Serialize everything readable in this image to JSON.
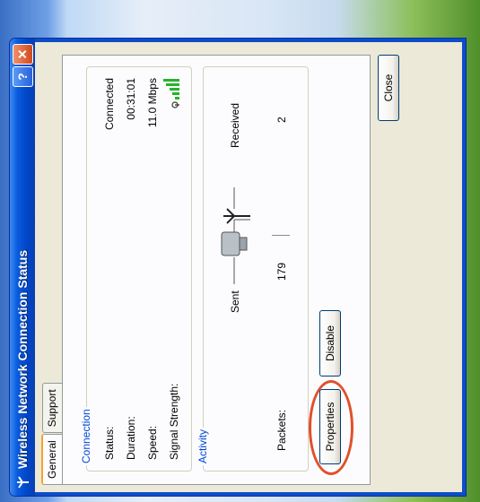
{
  "window": {
    "title": "Wireless Network Connection Status",
    "help_label": "?",
    "close_label": "✕"
  },
  "tabs": [
    {
      "label": "General"
    },
    {
      "label": "Support"
    }
  ],
  "connection": {
    "title": "Connection",
    "status_label": "Status:",
    "status_value": "Connected",
    "duration_label": "Duration:",
    "duration_value": "00:31:01",
    "speed_label": "Speed:",
    "speed_value": "11.0 Mbps",
    "signal_label": "Signal Strength:",
    "signal_bars": 5
  },
  "activity": {
    "title": "Activity",
    "sent_label": "Sent",
    "received_label": "Received",
    "packets_label": "Packets:",
    "packets_sent": "179",
    "packets_received": "2"
  },
  "buttons": {
    "properties": "Properties",
    "disable": "Disable",
    "close": "Close"
  },
  "colors": {
    "highlight_ring": "#e0502a",
    "signal": "#27b32a"
  }
}
